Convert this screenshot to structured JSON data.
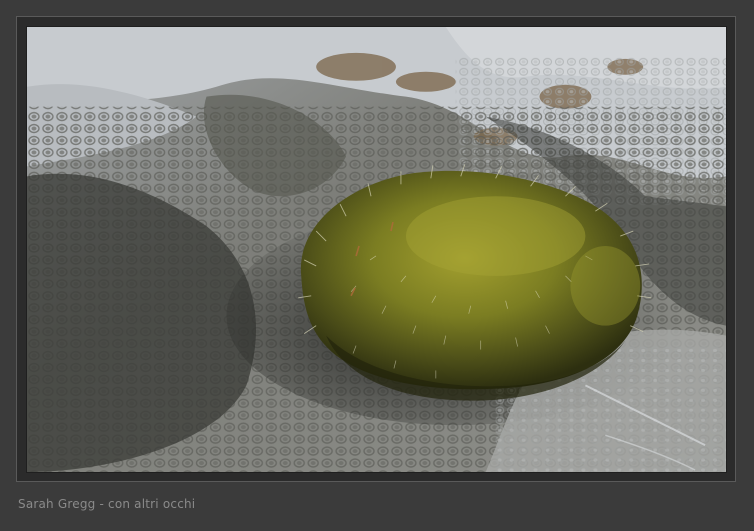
{
  "photo": {
    "subject": "moss-cushion-on-lichen-rock",
    "palette": {
      "rock_light": "#c9cdd2",
      "rock_mid": "#8b8c86",
      "rock_dark": "#4d4e4a",
      "shadow": "#2f302d",
      "moss_light": "#9a9a2e",
      "moss_mid": "#6f7420",
      "moss_dark": "#3a3d12",
      "lichen_brown": "#7a6448"
    }
  },
  "caption": {
    "credit": "Sarah Gregg - con altri occhi"
  }
}
